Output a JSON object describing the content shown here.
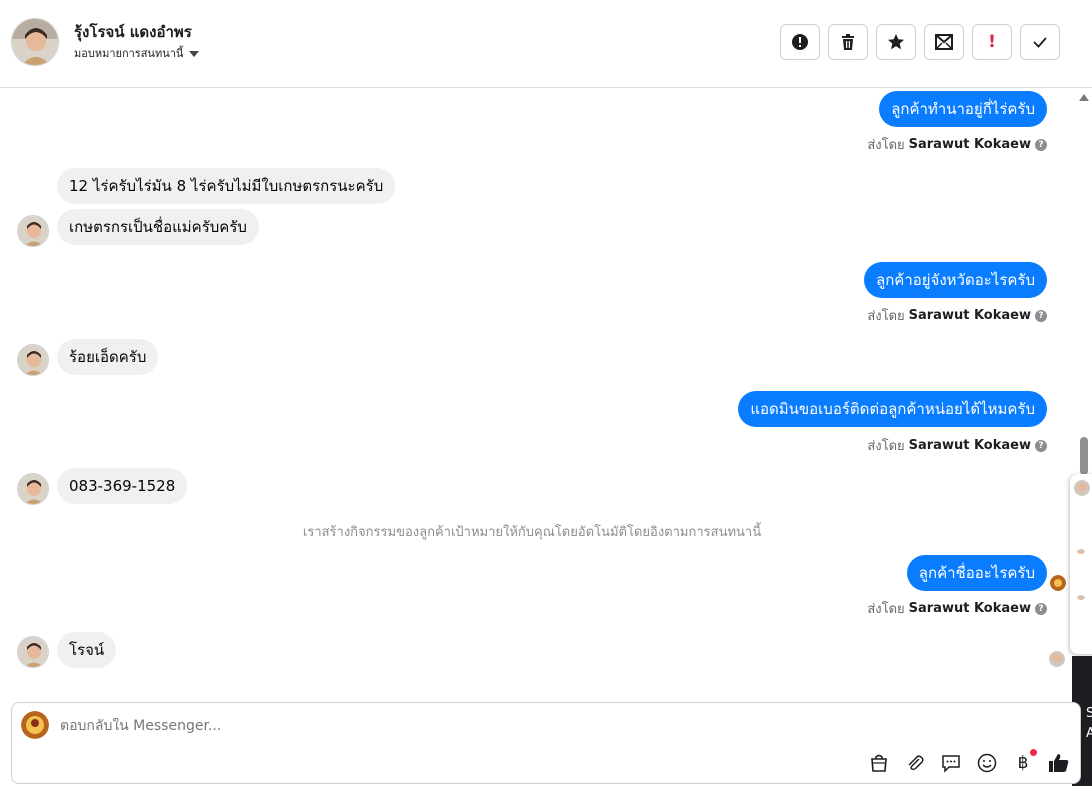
{
  "header": {
    "contact_name": "รุ้งโรจน์ แดงอำพร",
    "assign_label": "มอบหมายการสนทนานี้",
    "toolbar": [
      {
        "name": "spam-button",
        "icon": "alert-circle-icon"
      },
      {
        "name": "delete-button",
        "icon": "trash-icon"
      },
      {
        "name": "star-button",
        "icon": "star-icon"
      },
      {
        "name": "mark-unread-button",
        "icon": "mail-icon"
      },
      {
        "name": "follow-up-button",
        "icon": "exclamation-icon",
        "label": "!"
      },
      {
        "name": "mark-done-button",
        "icon": "check-icon"
      }
    ]
  },
  "conversation": {
    "messages": [
      {
        "direction": "out",
        "text": "ลูกค้าทำนาอยู่กี่ไร่ครับ"
      },
      {
        "direction": "in",
        "text": "12 ไร่ครับไร่มัน 8 ไร่ครับไม่มีใบเกษตรกรนะครับ"
      },
      {
        "direction": "in",
        "text": "เกษตรกรเป็นชื่อแม่ครับครับ"
      },
      {
        "direction": "out",
        "text": "ลูกค้าอยู่จังหวัดอะไรครับ"
      },
      {
        "direction": "in",
        "text": "ร้อยเอ็ดครับ"
      },
      {
        "direction": "out",
        "text": "แอดมินขอเบอร์ติดต่อลูกค้าหน่อยได้ไหมครับ"
      },
      {
        "direction": "in",
        "text": "083-369-1528"
      },
      {
        "direction": "out",
        "text": "ลูกค้าชื่ออะไรครับ"
      },
      {
        "direction": "in",
        "text": "โรจน์"
      }
    ],
    "sent_by_prefix": "ส่งโดย",
    "sent_by_name": "Sarawut Kokaew",
    "help_glyph": "?",
    "system_note": "เราสร้างกิจกรรมของลูกค้าเป้าหมายให้กับคุณโดยอัตโนมัติโดยอิงตามการสนทนานี้"
  },
  "side_panel_text": [
    "S",
    "A"
  ],
  "composer": {
    "placeholder": "ตอบกลับใน Messenger...",
    "icons": [
      "shopping-bag-icon",
      "paperclip-icon",
      "saved-reply-icon",
      "emoji-icon",
      "baht-payment-icon",
      "like-icon"
    ],
    "baht_glyph": "฿"
  },
  "colors": {
    "outgoing_bubble": "#0a7cff",
    "incoming_bubble": "#f0f0f0",
    "notification_dot": "#f02849"
  }
}
